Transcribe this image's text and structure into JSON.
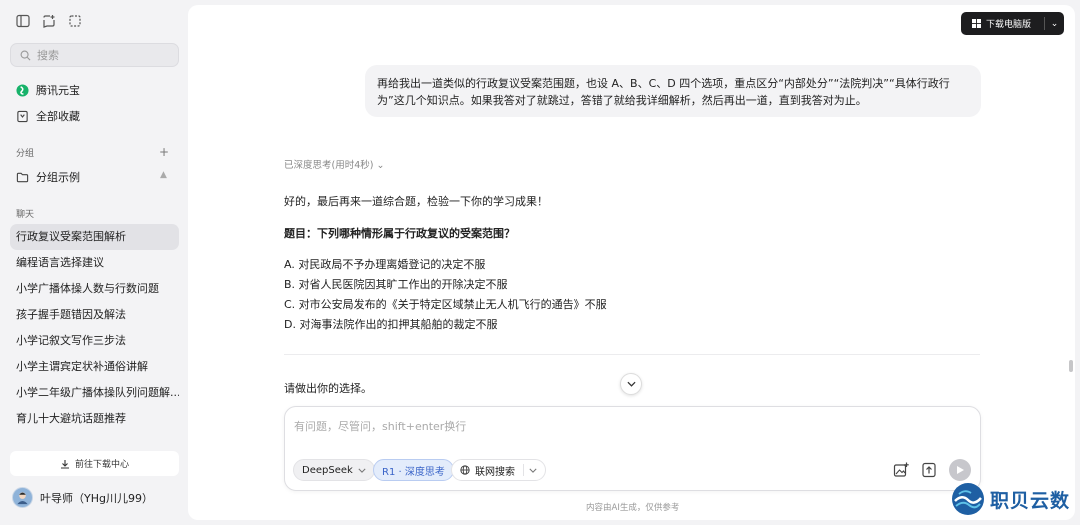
{
  "sidebar": {
    "search_placeholder": "搜索",
    "nav": [
      {
        "label": "腾讯元宝",
        "icon": "yuanbao-logo-icon"
      },
      {
        "label": "全部收藏",
        "icon": "bookmark-icon"
      }
    ],
    "group_section": "分组",
    "group_items": [
      {
        "label": "分组示例",
        "icon": "folder-icon"
      }
    ],
    "chat_section": "聊天",
    "chats": [
      {
        "label": "行政复议受案范围解析",
        "active": true
      },
      {
        "label": "编程语言选择建议"
      },
      {
        "label": "小学广播体操人数与行数问题"
      },
      {
        "label": "孩子握手题错因及解法"
      },
      {
        "label": "小学记叙文写作三步法"
      },
      {
        "label": "小学主谓宾定状补通俗讲解"
      },
      {
        "label": "小学二年级广播体操队列问题解..."
      },
      {
        "label": "育儿十大避坑话题推荐"
      }
    ],
    "download_center": "前往下载中心",
    "user_name": "叶导师（YHg川儿99）"
  },
  "header": {
    "download_pc": "下载电脑版"
  },
  "conversation": {
    "user_message": "再给我出一道类似的行政复议受案范围题，也设 A、B、C、D 四个选项，重点区分“内部处分”“法院判决”“具体行政行为”这几个知识点。如果我答对了就跳过，答错了就给我详细解析，然后再出一道，直到我答对为止。",
    "thinking_label": "已深度思考(用时4秒)",
    "intro": "好的，最后再来一道综合题，检验一下你的学习成果！",
    "question": "题目：下列哪种情形属于行政复议的受案范围？",
    "options": [
      "A. 对民政局不予办理离婚登记的决定不服",
      "B. 对省人民医院因其旷工作出的开除决定不服",
      "C. 对市公安局发布的《关于特定区域禁止无人机飞行的通告》不服",
      "D. 对海事法院作出的扣押其船舶的裁定不服"
    ],
    "prompt": "请做出你的选择。"
  },
  "composer": {
    "placeholder": "有问题，尽管问，shift+enter换行",
    "model": "DeepSeek",
    "deep_think": "R1 · 深度思考",
    "web_search": "联网搜索"
  },
  "footer_note": "内容由AI生成，仅供参考",
  "watermark_text": "职贝云数",
  "colors": {
    "accent": "#3a64c8",
    "dark_button": "#1d1d1f",
    "watermark": "#1e5fa3"
  }
}
